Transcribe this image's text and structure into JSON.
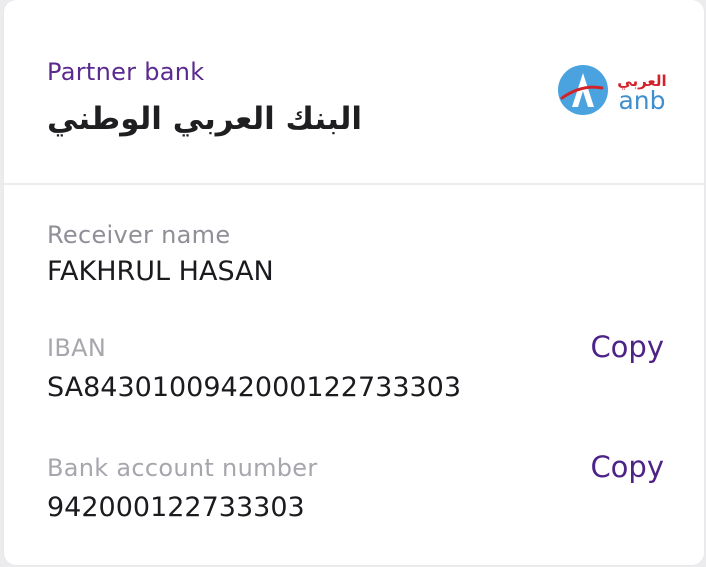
{
  "partner": {
    "label": "Partner bank",
    "bank_name": "البنك العربي الوطني",
    "logo": {
      "icon": "anb-logo-icon",
      "arabic_text": "العربي",
      "latin_text": "anb",
      "colors": {
        "circle": "#4aa3df",
        "swoosh": "#d2232a",
        "text": "#3f8fcf"
      }
    }
  },
  "receiver": {
    "label": "Receiver name",
    "value": "FAKHRUL HASAN"
  },
  "iban": {
    "label": "IBAN",
    "value": "SA8430100942000122733303",
    "copy_label": "Copy"
  },
  "account": {
    "label": "Bank account number",
    "value": "942000122733303",
    "copy_label": "Copy"
  },
  "colors": {
    "accent": "#4d2388",
    "partner_label": "#5b2a8f",
    "muted_label": "#a6a6ad"
  }
}
